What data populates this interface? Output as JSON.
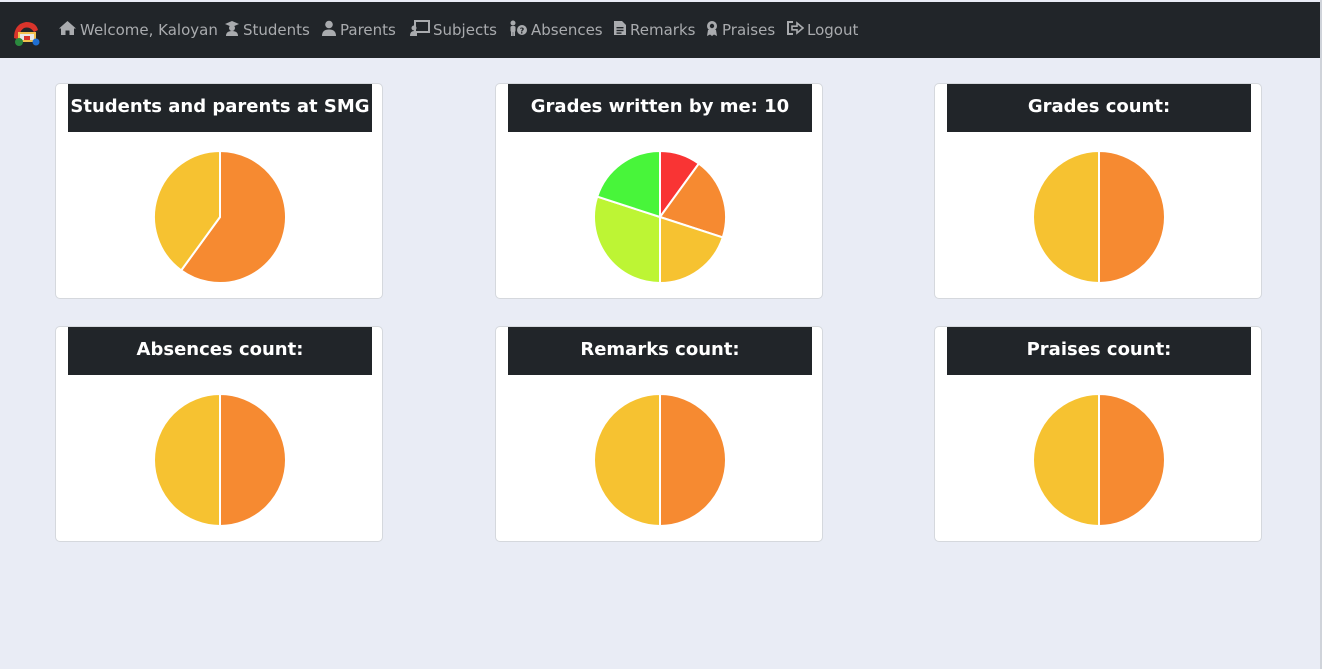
{
  "nav": {
    "welcome": "Welcome, Kaloyan",
    "students": "Students",
    "parents": "Parents",
    "subjects": "Subjects",
    "absences": "Absences",
    "remarks": "Remarks",
    "praises": "Praises",
    "logout": "Logout"
  },
  "colors": {
    "navbar": "#212529",
    "background": "#e9ecf5",
    "orange": "#f68a31",
    "yellow": "#f6c231",
    "red": "#f93434",
    "lime": "#bdf534",
    "green": "#48f53a"
  },
  "cards": [
    {
      "title": "Students and parents at SMG"
    },
    {
      "title": "Grades written by me: 10"
    },
    {
      "title": "Grades count:"
    },
    {
      "title": "Absences count:"
    },
    {
      "title": "Remarks count:"
    },
    {
      "title": "Praises count:"
    }
  ],
  "chart_data": [
    {
      "type": "pie",
      "values": [
        0.6,
        0.4
      ],
      "colors": [
        "#f68a31",
        "#f6c231"
      ]
    },
    {
      "type": "pie",
      "values": [
        1,
        2,
        2,
        3,
        2
      ],
      "colors": [
        "#f93434",
        "#f68a31",
        "#f6c231",
        "#bdf534",
        "#48f53a"
      ]
    },
    {
      "type": "pie",
      "values": [
        1,
        1
      ],
      "colors": [
        "#f68a31",
        "#f6c231"
      ]
    },
    {
      "type": "pie",
      "values": [
        1,
        1
      ],
      "colors": [
        "#f68a31",
        "#f6c231"
      ]
    },
    {
      "type": "pie",
      "values": [
        1,
        1
      ],
      "colors": [
        "#f68a31",
        "#f6c231"
      ]
    },
    {
      "type": "pie",
      "values": [
        1,
        1
      ],
      "colors": [
        "#f68a31",
        "#f6c231"
      ]
    }
  ]
}
